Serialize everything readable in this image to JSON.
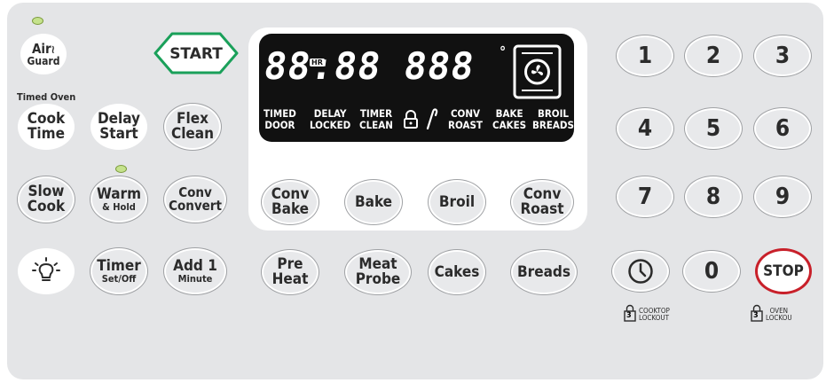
{
  "left": {
    "airguard": {
      "l1": "Air",
      "l2": "Guard"
    },
    "timed_oven": "Timed Oven",
    "cook_time": {
      "l1": "Cook",
      "l2": "Time"
    },
    "delay_start": {
      "l1": "Delay",
      "l2": "Start"
    },
    "flex_clean": {
      "l1": "Flex",
      "l2": "Clean"
    },
    "slow_cook": {
      "l1": "Slow",
      "l2": "Cook"
    },
    "warm_hold": {
      "l1": "Warm",
      "l2": "& Hold"
    },
    "conv_convert": {
      "l1": "Conv",
      "l2": "Convert"
    },
    "timer": {
      "l1": "Timer",
      "l2": "Set/Off"
    },
    "add1": {
      "l1": "Add 1",
      "l2": "Minute"
    }
  },
  "start": "START",
  "display": {
    "digits": "88:88 888",
    "hr": "HR",
    "degree": "°",
    "ind_timed": {
      "l1": "TIMED",
      "l2": "DOOR"
    },
    "ind_delay": {
      "l1": "DELAY",
      "l2": "LOCKED"
    },
    "ind_timer": {
      "l1": "TIMER",
      "l2": "CLEAN"
    },
    "ind_conv": {
      "l1": "CONV",
      "l2": "ROAST"
    },
    "ind_bake": {
      "l1": "BAKE",
      "l2": "CAKES"
    },
    "ind_broil": {
      "l1": "BROIL",
      "l2": "BREADS"
    }
  },
  "modes": {
    "conv_bake": {
      "l1": "Conv",
      "l2": "Bake"
    },
    "bake": "Bake",
    "broil": "Broil",
    "conv_roast": {
      "l1": "Conv",
      "l2": "Roast"
    },
    "preheat": {
      "l1": "Pre",
      "l2": "Heat"
    },
    "meat_probe": {
      "l1": "Meat",
      "l2": "Probe"
    },
    "cakes": "Cakes",
    "breads": "Breads"
  },
  "keypad": [
    "1",
    "2",
    "3",
    "4",
    "5",
    "6",
    "7",
    "8",
    "9"
  ],
  "zero": "0",
  "stop": "STOP",
  "cooktop_lockout": {
    "n": "3",
    "l1": "COOKTOP",
    "l2": "LOCKOUT"
  },
  "oven_lockout": {
    "n": "3",
    "l1": "OVEN",
    "l2": "LOCKOU"
  },
  "colors": {
    "panel": "#e4e5e7",
    "start_green": "#1aa05a",
    "stop_red": "#c8202a",
    "led": "#c5e28c"
  }
}
